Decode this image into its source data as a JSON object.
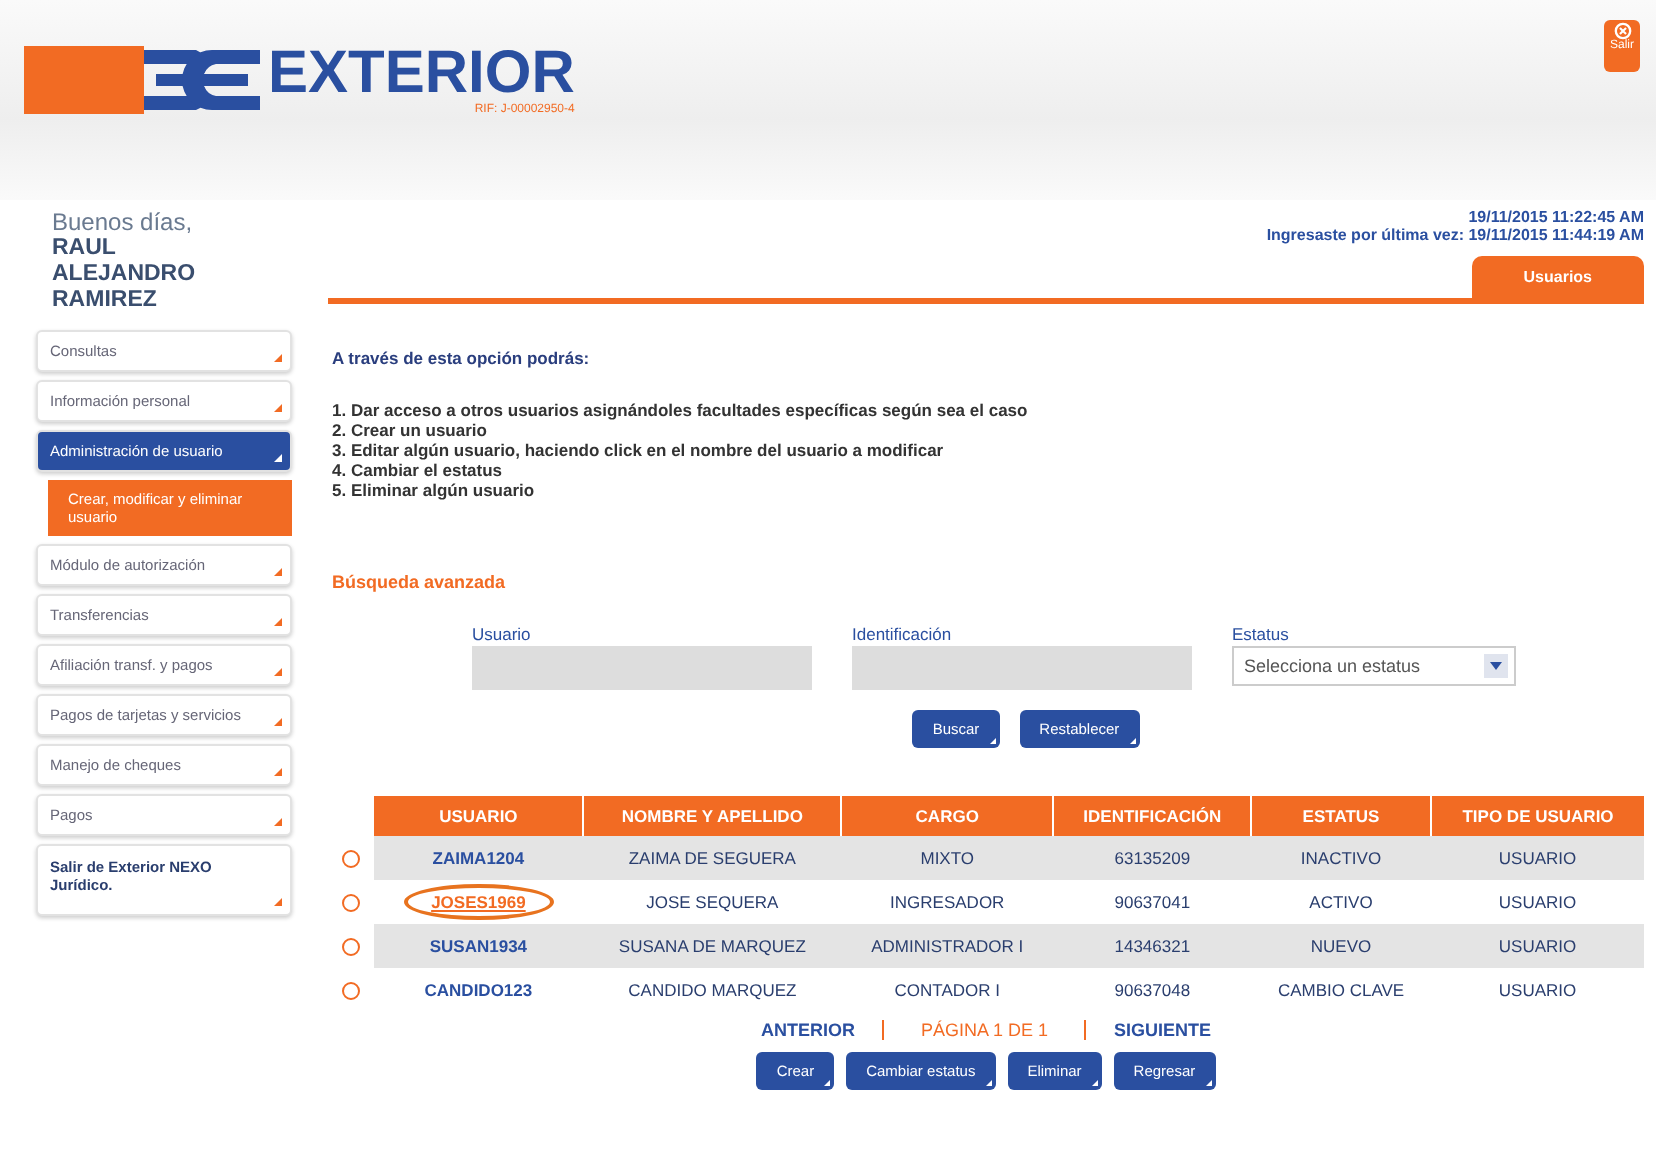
{
  "header": {
    "logo_text": "EXTERIOR",
    "rif": "RIF: J-00002950-4",
    "exit_label": "Salir"
  },
  "greeting": {
    "salutation": "Buenos días,",
    "name": "RAUL ALEJANDRO RAMIREZ"
  },
  "session": {
    "now": "19/11/2015 11:22:45 AM",
    "last_login_label": "Ingresaste por última vez:",
    "last_login": "19/11/2015 11:44:19 AM"
  },
  "tabs": [
    {
      "label": "Usuarios",
      "selected": true
    }
  ],
  "sidebar": {
    "items": [
      {
        "label": "Consultas",
        "kind": "menu",
        "selected": false
      },
      {
        "label": "Información personal",
        "kind": "menu",
        "selected": false
      },
      {
        "label": "Administración de usuario",
        "kind": "menu",
        "selected": true,
        "children": [
          {
            "label": "Crear, modificar y eliminar usuario",
            "selected": true
          }
        ]
      },
      {
        "label": "Módulo de autorización",
        "kind": "menu",
        "selected": false
      },
      {
        "label": "Transferencias",
        "kind": "menu",
        "selected": false
      },
      {
        "label": "Afiliación transf. y pagos",
        "kind": "menu",
        "selected": false
      },
      {
        "label": "Pagos de tarjetas y servicios",
        "kind": "menu",
        "selected": false
      },
      {
        "label": "Manejo de cheques",
        "kind": "menu",
        "selected": false
      },
      {
        "label": "Pagos",
        "kind": "menu",
        "selected": false
      },
      {
        "label": "Salir de Exterior NEXO Jurídico.",
        "kind": "exit",
        "selected": false
      }
    ]
  },
  "intro": {
    "heading": "A través de esta opción podrás:",
    "steps": [
      "1. Dar acceso a otros usuarios asignándoles facultades específicas según sea el caso",
      "2. Crear un usuario",
      "3. Editar algún usuario, haciendo click en el nombre del usuario a modificar",
      "4. Cambiar el estatus",
      "5. Eliminar algún usuario"
    ]
  },
  "search": {
    "title": "Búsqueda avanzada",
    "fields": [
      {
        "label": "Usuario",
        "kind": "text"
      },
      {
        "label": "Identificación",
        "kind": "text"
      },
      {
        "label": "Estatus",
        "kind": "select",
        "value": "Selecciona un estatus"
      }
    ],
    "buttons": [
      "Buscar",
      "Restablecer"
    ]
  },
  "table": {
    "columns": [
      "USUARIO",
      "NOMBRE Y APELLIDO",
      "CARGO",
      "IDENTIFICACIÓN",
      "ESTATUS",
      "TIPO DE USUARIO"
    ],
    "rows": [
      {
        "selected": false,
        "circled": false,
        "cells": [
          "ZAIMA1204",
          "ZAIMA DE SEGUERA",
          "MIXTO",
          "63135209",
          "INACTIVO",
          "USUARIO"
        ]
      },
      {
        "selected": false,
        "circled": true,
        "cells": [
          "JOSES1969",
          "JOSE SEQUERA",
          "INGRESADOR",
          "90637041",
          "ACTIVO",
          "USUARIO"
        ]
      },
      {
        "selected": false,
        "circled": false,
        "cells": [
          "SUSAN1934",
          "SUSANA DE MARQUEZ",
          "ADMINISTRADOR I",
          "14346321",
          "NUEVO",
          "USUARIO"
        ]
      },
      {
        "selected": false,
        "circled": false,
        "cells": [
          "CANDIDO123",
          "CANDIDO MARQUEZ",
          "CONTADOR I",
          "90637048",
          "CAMBIO CLAVE",
          "USUARIO"
        ]
      }
    ]
  },
  "pagination": {
    "previous": "ANTERIOR",
    "page": "PÁGINA 1 DE 1",
    "next": "SIGUIENTE"
  },
  "actions": [
    "Crear",
    "Cambiar estatus",
    "Eliminar",
    "Regresar"
  ]
}
